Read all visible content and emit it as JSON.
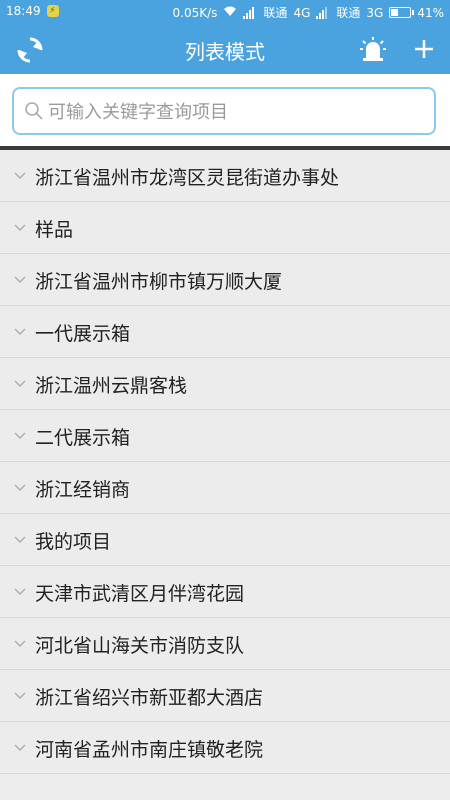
{
  "status_bar": {
    "time": "18:49",
    "speed": "0.05K/s",
    "carrier1": "联通",
    "net1": "4G",
    "carrier2": "联通",
    "net2": "3G",
    "battery": "41%",
    "battery_level": 0.41
  },
  "header": {
    "title": "列表模式",
    "left_icon": "refresh-icon",
    "right_icons": [
      "alarm-icon",
      "add-icon"
    ],
    "color": "#4aa3df"
  },
  "search": {
    "placeholder": "可输入关键字查询项目",
    "value": ""
  },
  "list": {
    "items": [
      {
        "label": "浙江省温州市龙湾区灵昆街道办事处"
      },
      {
        "label": "样品"
      },
      {
        "label": "浙江省温州市柳市镇万顺大厦"
      },
      {
        "label": "一代展示箱"
      },
      {
        "label": "浙江温州云鼎客栈"
      },
      {
        "label": "二代展示箱"
      },
      {
        "label": "浙江经销商"
      },
      {
        "label": "我的项目"
      },
      {
        "label": "天津市武清区月伴湾花园"
      },
      {
        "label": "河北省山海关市消防支队"
      },
      {
        "label": "浙江省绍兴市新亚都大酒店"
      },
      {
        "label": "河南省孟州市南庄镇敬老院"
      }
    ]
  }
}
